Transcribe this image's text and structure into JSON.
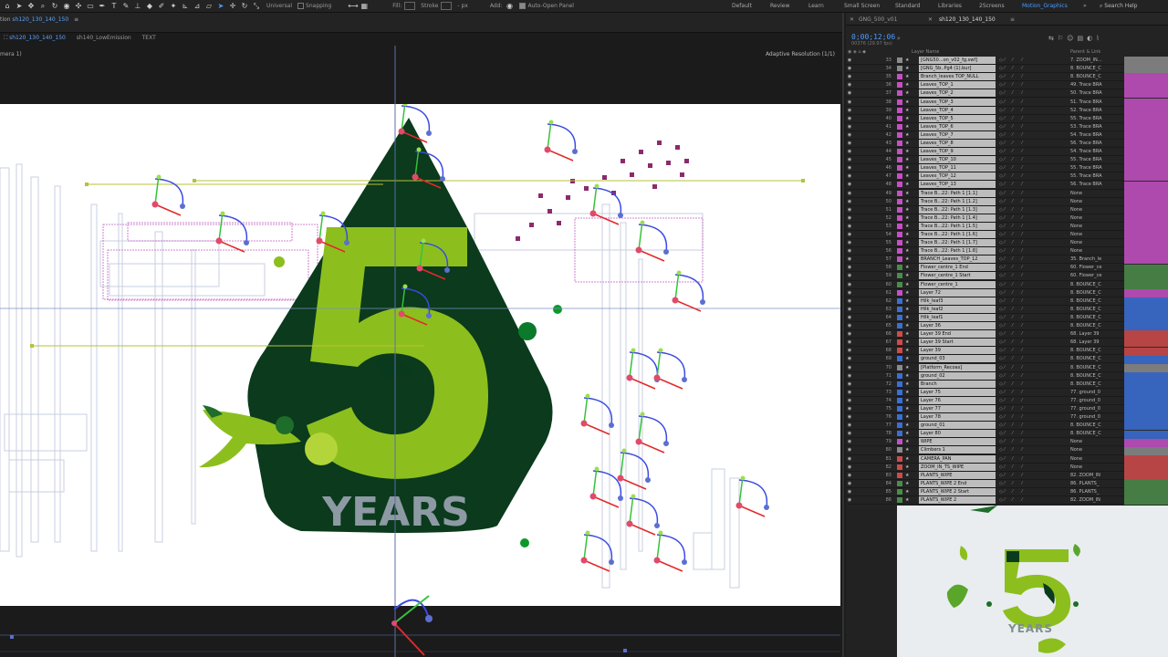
{
  "toolbar": {
    "universal_label": "Universal",
    "snapping_label": "Snapping",
    "fill_label": "Fill:",
    "fill_value": "",
    "stroke_label": "Stroke",
    "stroke_value": "",
    "px_label": "- px",
    "add_label": "Add:",
    "auto_open_label": "Auto-Open Panel"
  },
  "workspaces": [
    "Default",
    "Review",
    "Learn",
    "Small Screen",
    "Standard",
    "Libraries",
    "2Screens",
    "Motion_Graphics"
  ],
  "search_help": "Search Help",
  "composition": {
    "tab_prefix": "tion",
    "tab_name": "sh120_130_140_150",
    "breadcrumbs": [
      "sh120_130_140_150",
      "sh140_LowEmission",
      "TEXT"
    ],
    "viewer_label": "mera 1)",
    "resolution": "Adaptive Resolution (1/1)",
    "artwork_years": "YEARS"
  },
  "timeline": {
    "tabs": [
      "GNG_500_v01",
      "sh120_130_140_150"
    ],
    "timecode": "0;00;12;06",
    "frame_info": "00376 (29.97 fps)",
    "col_layer_name": "Layer Name",
    "col_parent": "Parent & Link",
    "layers": [
      {
        "n": "33",
        "name": "[GNG50...on_v02_fg.swf]",
        "color": "#8b8b8b",
        "parent": "7. ZOOM_IN..."
      },
      {
        "n": "34",
        "name": "[GNG_5b..Pg4 (1).bur]",
        "color": "#8b8b8b",
        "parent": "8. BOUNCE_C"
      },
      {
        "n": "35",
        "name": "Branch_leaves TOP_NULL",
        "color": "#c54fc5",
        "parent": "8. BOUNCE_C"
      },
      {
        "n": "36",
        "name": "Leaves_TOP_1",
        "color": "#c54fc5",
        "parent": "49. Trace BRA"
      },
      {
        "n": "37",
        "name": "Leaves_TOP_2",
        "color": "#c54fc5",
        "parent": "50. Trace BRA"
      },
      {
        "n": "38",
        "name": "Leaves_TOP_3",
        "color": "#c54fc5",
        "parent": "51. Trace BRA"
      },
      {
        "n": "39",
        "name": "Leaves_TOP_4",
        "color": "#c54fc5",
        "parent": "52. Trace BRA"
      },
      {
        "n": "40",
        "name": "Leaves_TOP_5",
        "color": "#c54fc5",
        "parent": "55. Trace BRA"
      },
      {
        "n": "41",
        "name": "Leaves_TOP_6",
        "color": "#c54fc5",
        "parent": "53. Trace BRA"
      },
      {
        "n": "42",
        "name": "Leaves_TOP_7",
        "color": "#c54fc5",
        "parent": "54. Trace BRA"
      },
      {
        "n": "43",
        "name": "Leaves_TOP_8",
        "color": "#c54fc5",
        "parent": "56. Trace BRA"
      },
      {
        "n": "44",
        "name": "Leaves_TOP_9",
        "color": "#c54fc5",
        "parent": "54. Trace BRA"
      },
      {
        "n": "45",
        "name": "Leaves_TOP_10",
        "color": "#c54fc5",
        "parent": "55. Trace BRA"
      },
      {
        "n": "46",
        "name": "Leaves_TOP_11",
        "color": "#c54fc5",
        "parent": "55. Trace BRA"
      },
      {
        "n": "47",
        "name": "Leaves_TOP_12",
        "color": "#c54fc5",
        "parent": "55. Trace BRA"
      },
      {
        "n": "48",
        "name": "Leaves_TOP_13",
        "color": "#c54fc5",
        "parent": "56. Trace BRA"
      },
      {
        "n": "49",
        "name": "Trace B...22: Path 1 [1.1]",
        "color": "#c54fc5",
        "parent": "None"
      },
      {
        "n": "50",
        "name": "Trace B...22: Path 1 [1.2]",
        "color": "#c54fc5",
        "parent": "None"
      },
      {
        "n": "51",
        "name": "Trace B...22: Path 1 [1.3]",
        "color": "#c54fc5",
        "parent": "None"
      },
      {
        "n": "52",
        "name": "Trace B...22: Path 1 [1.4]",
        "color": "#c54fc5",
        "parent": "None"
      },
      {
        "n": "53",
        "name": "Trace B...22: Path 1 [1.5]",
        "color": "#c54fc5",
        "parent": "None"
      },
      {
        "n": "54",
        "name": "Trace B...22: Path 1 [1.6]",
        "color": "#c54fc5",
        "parent": "None"
      },
      {
        "n": "55",
        "name": "Trace B...22: Path 1 [1.7]",
        "color": "#c54fc5",
        "parent": "None"
      },
      {
        "n": "56",
        "name": "Trace B...22: Path 1 [1.8]",
        "color": "#c54fc5",
        "parent": "None"
      },
      {
        "n": "57",
        "name": "BRANCH_Leaves_TOP_12",
        "color": "#c54fc5",
        "parent": "35. Branch_le"
      },
      {
        "n": "58",
        "name": "Flower_centre_1 End",
        "color": "#4a8c4a",
        "parent": "60. Flower_ce"
      },
      {
        "n": "59",
        "name": "Flower_centre_1 Start",
        "color": "#4a8c4a",
        "parent": "60. Flower_ce"
      },
      {
        "n": "60",
        "name": "Flower_centre_1",
        "color": "#4a8c4a",
        "parent": "8. BOUNCE_C"
      },
      {
        "n": "61",
        "name": "Layer 72",
        "color": "#c54fc5",
        "parent": "8. BOUNCE_C"
      },
      {
        "n": "62",
        "name": "Hilk_leaf3",
        "color": "#3a6fd6",
        "parent": "8. BOUNCE_C"
      },
      {
        "n": "63",
        "name": "Hilk_leaf2",
        "color": "#3a6fd6",
        "parent": "8. BOUNCE_C"
      },
      {
        "n": "64",
        "name": "Hilk_leaf1",
        "color": "#3a6fd6",
        "parent": "8. BOUNCE_C"
      },
      {
        "n": "65",
        "name": "Layer 36",
        "color": "#3a6fd6",
        "parent": "8. BOUNCE_C"
      },
      {
        "n": "66",
        "name": "Layer 39 End",
        "color": "#d04a4a",
        "parent": "68. Layer 39"
      },
      {
        "n": "67",
        "name": "Layer 39 Start",
        "color": "#d04a4a",
        "parent": "68. Layer 39"
      },
      {
        "n": "68",
        "name": "Layer 39",
        "color": "#d04a4a",
        "parent": "8. BOUNCE_C"
      },
      {
        "n": "69",
        "name": "ground_03",
        "color": "#3a6fd6",
        "parent": "8. BOUNCE_C"
      },
      {
        "n": "70",
        "name": "[Platform_Recoas]",
        "color": "#8b8b8b",
        "parent": "8. BOUNCE_C"
      },
      {
        "n": "71",
        "name": "ground_02",
        "color": "#3a6fd6",
        "parent": "8. BOUNCE_C"
      },
      {
        "n": "72",
        "name": "Branch",
        "color": "#3a6fd6",
        "parent": "8. BOUNCE_C"
      },
      {
        "n": "73",
        "name": "Layer 75",
        "color": "#3a6fd6",
        "parent": "77. ground_0"
      },
      {
        "n": "74",
        "name": "Layer 76",
        "color": "#3a6fd6",
        "parent": "77. ground_0"
      },
      {
        "n": "75",
        "name": "Layer 77",
        "color": "#3a6fd6",
        "parent": "77. ground_0"
      },
      {
        "n": "76",
        "name": "Layer 78",
        "color": "#3a6fd6",
        "parent": "77. ground_0"
      },
      {
        "n": "77",
        "name": "ground_01",
        "color": "#3a6fd6",
        "parent": "8. BOUNCE_C"
      },
      {
        "n": "78",
        "name": "Layer 80",
        "color": "#3a6fd6",
        "parent": "8. BOUNCE_C"
      },
      {
        "n": "79",
        "name": "WIPE",
        "color": "#c54fc5",
        "parent": "None"
      },
      {
        "n": "80",
        "name": "Climbers 1",
        "color": "#8b8b8b",
        "parent": "None"
      },
      {
        "n": "81",
        "name": "CAMERA_PAN",
        "color": "#d04a4a",
        "parent": "None"
      },
      {
        "n": "82",
        "name": "ZOOM_IN_TS_WIPE",
        "color": "#d04a4a",
        "parent": "None"
      },
      {
        "n": "83",
        "name": "PLANTS_WIPE",
        "color": "#d04a4a",
        "parent": "82. ZOOM_IN"
      },
      {
        "n": "84",
        "name": "PLANTS_WIPE 2 End",
        "color": "#4a8c4a",
        "parent": "86. PLANTS_"
      },
      {
        "n": "85",
        "name": "PLANTS_WIPE 2 Start",
        "color": "#4a8c4a",
        "parent": "86. PLANTS_"
      },
      {
        "n": "86",
        "name": "PLANTS_WIPE 2",
        "color": "#4a8c4a",
        "parent": "82. ZOOM_IN"
      }
    ]
  },
  "preview": {
    "years": "YEARS"
  },
  "colors": {
    "accent": "#4a9dff",
    "dark_green": "#0d3b1e",
    "lime": "#8cbf1e",
    "years_gray": "#8d9aa3"
  }
}
